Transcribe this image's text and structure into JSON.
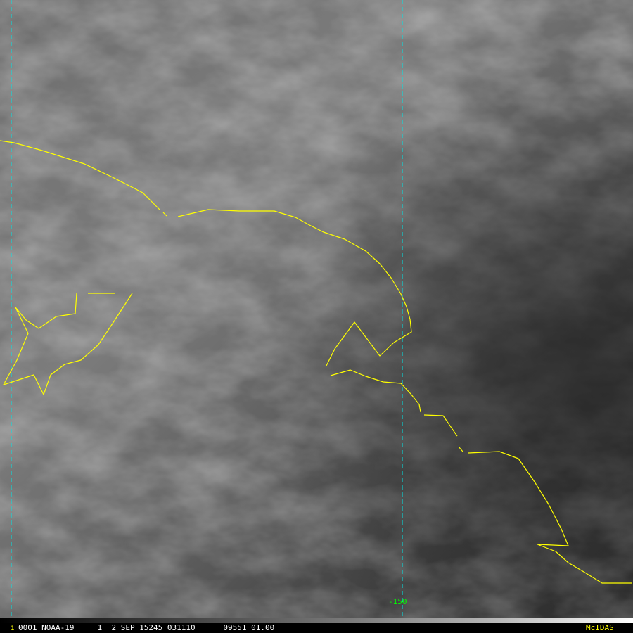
{
  "map": {
    "longitude_label": "-150",
    "colors": {
      "coastline": "#ffff00",
      "graticule": "#00e5e5",
      "label": "#00ff00",
      "brand": "#ffff00"
    }
  },
  "status_bar": {
    "frame_number": "1",
    "text": "0001 NOAA-19     1  2 SEP 15245 031110      09551 01.00",
    "brand": "McIDAS"
  }
}
